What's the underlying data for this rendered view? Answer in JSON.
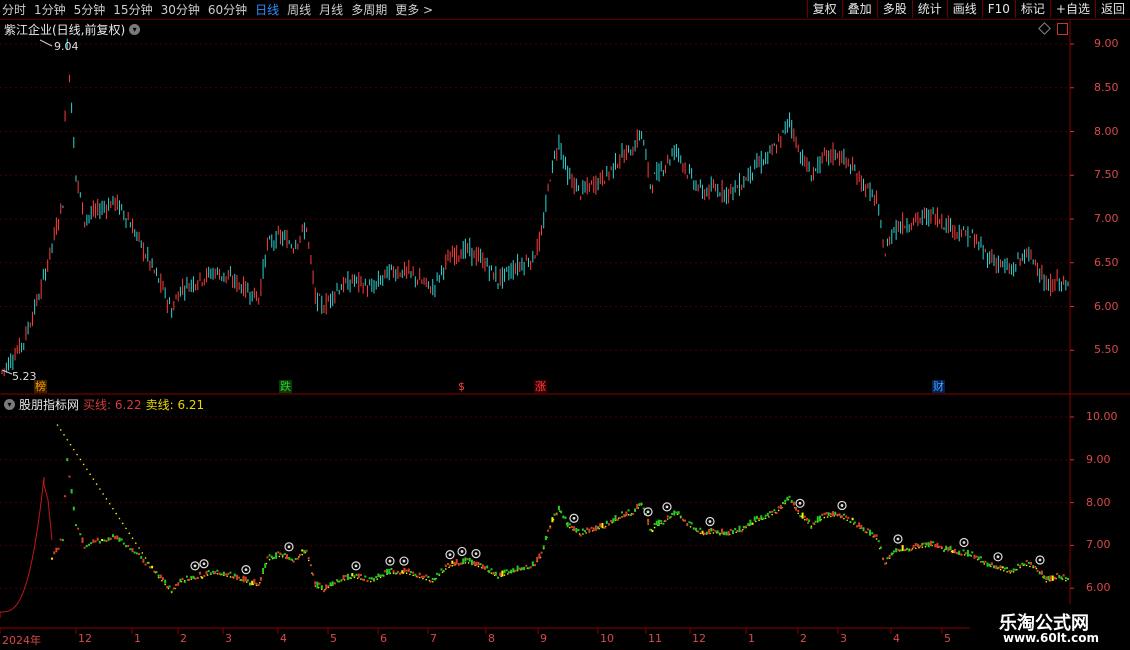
{
  "toolbar": {
    "periods": [
      "分时",
      "1分钟",
      "5分钟",
      "15分钟",
      "30分钟",
      "60分钟",
      "日线",
      "周线",
      "月线",
      "多周期",
      "更多 >"
    ],
    "active": "日线",
    "right_buttons": [
      "复权",
      "叠加",
      "多股",
      "统计",
      "画线",
      "F10",
      "标记",
      "+自选",
      "返回"
    ]
  },
  "main_panel": {
    "title": "紫江企业(日线,前复权)",
    "y_ticks": [
      "9.00",
      "8.50",
      "8.00",
      "7.50",
      "7.00",
      "6.50",
      "6.00",
      "5.50"
    ],
    "high_label": "9.04",
    "low_label": "5.23",
    "events": [
      {
        "label": "榜",
        "color": "#ff9900",
        "bg": "#3a2200"
      },
      {
        "label": "跌",
        "color": "#2ad02a",
        "bg": "#0a3a0a"
      },
      {
        "label": "$",
        "color": "#ff4040",
        "bg": "#000"
      },
      {
        "label": "涨",
        "color": "#ff4040",
        "bg": "#3a0000"
      },
      {
        "label": "财",
        "color": "#4aa0ff",
        "bg": "#002050"
      }
    ]
  },
  "indicator_panel": {
    "name": "股朋指标网",
    "buy_label": "买线: 6.22",
    "sell_label": "卖线: 6.21",
    "y_ticks": [
      "10.00",
      "9.00",
      "8.00",
      "7.00",
      "6.00"
    ]
  },
  "dates": [
    "2024年",
    "12",
    "1",
    "2",
    "3",
    "4",
    "5",
    "6",
    "7",
    "8",
    "9",
    "10",
    "11",
    "12",
    "1",
    "2",
    "3",
    "4",
    "5"
  ],
  "watermark": {
    "line1": "乐淘公式网",
    "line2": "www.60lt.com"
  },
  "colors": {
    "up": "#ff3c3c",
    "down": "#2ed4d4",
    "green": "#22cc22",
    "yellow": "#ffee00",
    "grid": "#4a0000"
  }
}
